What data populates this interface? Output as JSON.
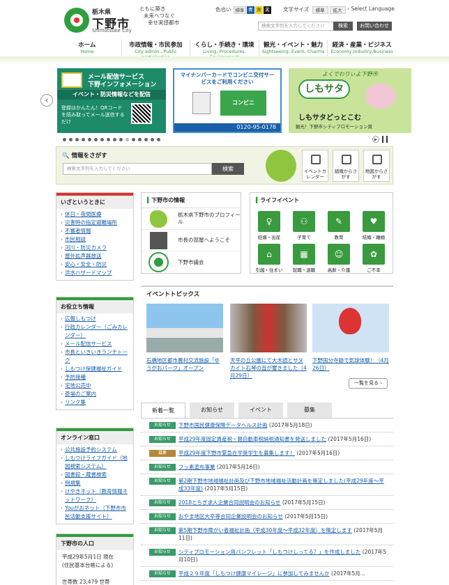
{
  "header": {
    "pref": "栃木県",
    "city": "下野市",
    "city_en": "Shimotsuke City",
    "slogan": [
      "ともに築き",
      "未来へつなぐ",
      "幸せ実感都市"
    ],
    "color_label": "色合い",
    "color_opts": [
      "標準",
      "青",
      "黄",
      "黒"
    ],
    "font_label": "文字サイズ",
    "font_opts": [
      "標準",
      "拡大"
    ],
    "lang": "Select Language",
    "search_placeholder": "検索文字列を入力してください",
    "search_btn": "検索",
    "contact_btn": "お問い合わせ"
  },
  "nav": [
    {
      "jp": "ホーム",
      "en": "Home"
    },
    {
      "jp": "市政情報・市民参加",
      "en": "City admin., Public participation"
    },
    {
      "jp": "くらし・手続き・環境",
      "en": "Living, Procedures, Environment"
    },
    {
      "jp": "観光・イベント・魅力",
      "en": "Sightseeing, Event, Charms"
    },
    {
      "jp": "経済・産業・ビジネス",
      "en": "Economy,Industry,Business"
    }
  ],
  "banners": {
    "b1_title1": "メール配信サービス",
    "b1_title2": "下野インフォメーション",
    "b1_sub": "イベント・防災情報などを配信",
    "b1_note": "登録はかんたん！QRコードを読み取ってメール送信するだけ",
    "b2_title": "マイナンバーカードでコンビニ交付サービスをご利用ください",
    "b2_label": "コンビニ",
    "b2_tel": "0120-95-0178",
    "b3_top": "よくでわりぃよ下野市",
    "b3_name": "しもサタ",
    "b3_main": "しもサタどっとこむ",
    "b3_sub": "観光！下野市シティプロモーション頁"
  },
  "search_area": {
    "title": "情報をさがす",
    "placeholder": "検索文字列を入力してください",
    "button": "検索",
    "quick": [
      "イベントカレンダー",
      "組織からさがす",
      "地図からさがす"
    ]
  },
  "emergency": {
    "title": "いざというときに",
    "items": [
      "休日・夜間医療",
      "災害時の指定避難場所",
      "不審者情報",
      "市民相談",
      "河川・防災カメラ",
      "屋外拡声器放送",
      "安心・安全・防災",
      "洪水ハザードマップ"
    ]
  },
  "useful": {
    "title": "お役立ち情報",
    "items": [
      "広報しもつけ",
      "行政カレンダー（ごみカレンダー）",
      "メール配信サービス",
      "市長といきいきランチトーク",
      "しもつけ保健福祉ガイド",
      "予防接種",
      "宅地公売中",
      "斎場のご案内",
      "リンク集"
    ]
  },
  "online": {
    "title": "オンライン窓口",
    "items": [
      "公共施設予約システム",
      "しもつけライフガイド（地図検索システム）",
      "図書館・蔵書検索",
      "例規集",
      "けやきネット（教育情報ネットワーク）",
      "Youがおネット（下野市市民活動支援サイト）"
    ]
  },
  "population": {
    "title": "下野市の人口",
    "date": "平成29年5月1日 現在",
    "basis": "(住民基本台帳による)",
    "households": "世帯数 23,479 世帯"
  },
  "city_info": {
    "title": "下野市の情報",
    "items": [
      "栃木県下野市のプロフィール",
      "市長の部屋へようこそ",
      "下野市議会"
    ]
  },
  "life_events": {
    "title": "ライフイベント",
    "items": [
      "妊娠・出産",
      "子育て",
      "教育",
      "結婚・離婚",
      "引越・住まい",
      "就職・退職",
      "高齢・介護",
      "ご不幸"
    ]
  },
  "event_topics": {
    "title": "イベントトピックス",
    "cards": [
      "石橋地区都市農村交流施設「ゆうがおパーク」オープン",
      "天平の丘公園にて大木読とサヌカイト石琴の音が響きました（4月29日）",
      "下野国分寺跡で気球体験！（4月26日）"
    ],
    "more": "一覧を見る"
  },
  "news": {
    "tabs": [
      "新着一覧",
      "お知らせ",
      "イベント",
      "募集"
    ],
    "items": [
      {
        "tag": "お知らせ",
        "text": "下野市国民健康保険データヘルス計画",
        "date": "(2017年5月18日)"
      },
      {
        "tag": "お知らせ",
        "text": "平成29年度固定資産税・軽自動車税納税通知書を発送しました",
        "date": "(2017年5月16日)"
      },
      {
        "tag": "募集",
        "text": "平成29年度下野市緊急在学奨学生を募集します！",
        "date": "(2017年5月16日)"
      },
      {
        "tag": "お知らせ",
        "text": "フッ素塗布事業",
        "date": "(2017年5月16日)"
      },
      {
        "tag": "お知らせ",
        "text": "第2期下野市地域福祉計画及び下野市地域福祉活動計画を策定しました(平成29年度～平成33年度)",
        "date": "(2017年5月15日)"
      },
      {
        "tag": "お知らせ",
        "text": "2018とちぎ求人企業合同説明会のお知らせ",
        "date": "(2017年5月15日)"
      },
      {
        "tag": "お知らせ",
        "text": "おやま地区大卒等合同企業説明会のお知らせ",
        "date": "(2017年5月15日)"
      },
      {
        "tag": "お知らせ",
        "text": "第5期下野市障がい者福祉計画（平成30年度～平成32年度）を策定します",
        "date": "(2017年5月11日)"
      },
      {
        "tag": "お知らせ",
        "text": "シティプロモーション用パンフレット「しもつけしってる？」を作成しました",
        "date": "(2017年5月10日)"
      },
      {
        "tag": "お知らせ",
        "text": "平成２９年度「しもつけ健康マイレージ」に参加してみませんか",
        "date": "(2017年5月..."
      }
    ]
  }
}
